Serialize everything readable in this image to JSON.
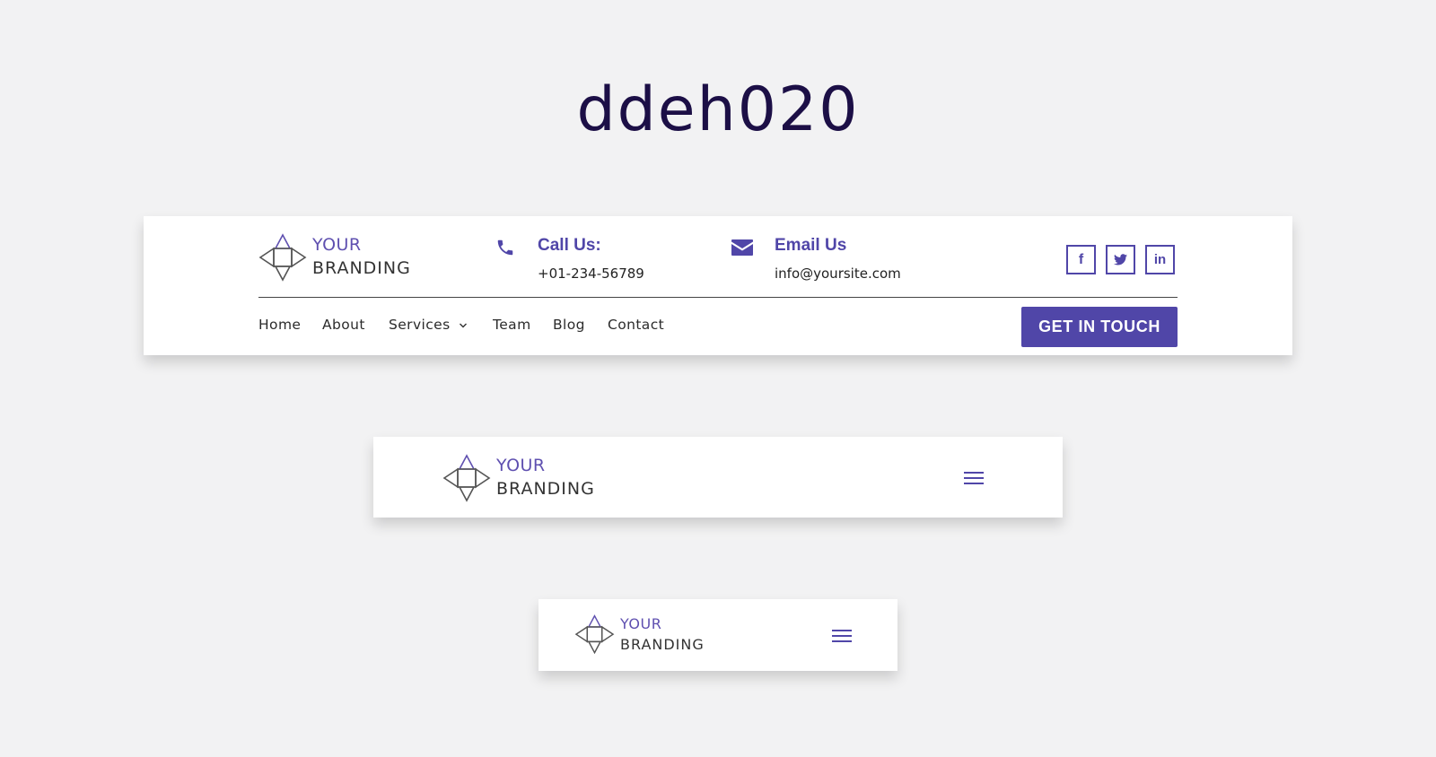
{
  "page": {
    "title": "ddeh020"
  },
  "brand": {
    "line1": "YOUR",
    "line2": "BRANDING",
    "accent_color": "#5046a8",
    "text_color": "#333333"
  },
  "contact": {
    "call_title": "Call Us:",
    "call_value": "+01-234-56789",
    "email_title": "Email Us",
    "email_value": "info@yoursite.com"
  },
  "social": [
    {
      "icon": "facebook-icon",
      "glyph": "f"
    },
    {
      "icon": "twitter-icon",
      "glyph": "🐦"
    },
    {
      "icon": "linkedin-icon",
      "glyph": "in"
    }
  ],
  "nav": {
    "items": [
      {
        "label": "Home"
      },
      {
        "label": "About"
      },
      {
        "label": "Services"
      },
      {
        "label": "Team"
      },
      {
        "label": "Blog"
      },
      {
        "label": "Contact"
      }
    ],
    "dropdown_glyph": "⌄"
  },
  "cta": {
    "label": "GET IN TOUCH"
  }
}
